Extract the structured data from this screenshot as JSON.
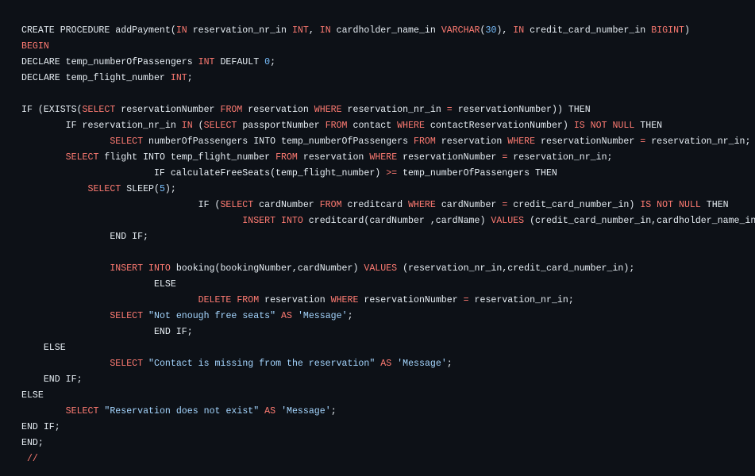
{
  "code_block": {
    "lines": [
      [
        [
          "CREATE PROCEDURE addPayment(",
          "plain"
        ],
        [
          "IN",
          "keyword"
        ],
        [
          " reservation_nr_in ",
          "plain"
        ],
        [
          "INT",
          "keyword"
        ],
        [
          ", ",
          "plain"
        ],
        [
          "IN",
          "keyword"
        ],
        [
          " cardholder_name_in ",
          "plain"
        ],
        [
          "VARCHAR",
          "keyword"
        ],
        [
          "(",
          "plain"
        ],
        [
          "30",
          "number"
        ],
        [
          "), ",
          "plain"
        ],
        [
          "IN",
          "keyword"
        ],
        [
          " credit_card_number_in ",
          "plain"
        ],
        [
          "BIGINT",
          "keyword"
        ],
        [
          ")",
          "plain"
        ]
      ],
      [
        [
          "BEGIN",
          "keyword"
        ]
      ],
      [
        [
          "DECLARE temp_numberOfPassengers ",
          "plain"
        ],
        [
          "INT",
          "keyword"
        ],
        [
          " DEFAULT ",
          "plain"
        ],
        [
          "0",
          "number"
        ],
        [
          ";",
          "plain"
        ]
      ],
      [
        [
          "DECLARE temp_flight_number ",
          "plain"
        ],
        [
          "INT",
          "keyword"
        ],
        [
          ";",
          "plain"
        ]
      ],
      [],
      [
        [
          "IF (EXISTS(",
          "plain"
        ],
        [
          "SELECT",
          "keyword"
        ],
        [
          " reservationNumber ",
          "plain"
        ],
        [
          "FROM",
          "keyword"
        ],
        [
          " reservation ",
          "plain"
        ],
        [
          "WHERE",
          "keyword"
        ],
        [
          " reservation_nr_in ",
          "plain"
        ],
        [
          "=",
          "op"
        ],
        [
          " reservationNumber)) THEN",
          "plain"
        ]
      ],
      [
        [
          "        IF reservation_nr_in ",
          "plain"
        ],
        [
          "IN",
          "keyword"
        ],
        [
          " (",
          "plain"
        ],
        [
          "SELECT",
          "keyword"
        ],
        [
          " passportNumber ",
          "plain"
        ],
        [
          "FROM",
          "keyword"
        ],
        [
          " contact ",
          "plain"
        ],
        [
          "WHERE",
          "keyword"
        ],
        [
          " contactReservationNumber) ",
          "plain"
        ],
        [
          "IS NOT NULL",
          "keyword"
        ],
        [
          " THEN",
          "plain"
        ]
      ],
      [
        [
          "                ",
          "plain"
        ],
        [
          "SELECT",
          "keyword"
        ],
        [
          " numberOfPassengers INTO temp_numberOfPassengers ",
          "plain"
        ],
        [
          "FROM",
          "keyword"
        ],
        [
          " reservation ",
          "plain"
        ],
        [
          "WHERE",
          "keyword"
        ],
        [
          " reservationNumber ",
          "plain"
        ],
        [
          "=",
          "op"
        ],
        [
          " reservation_nr_in;",
          "plain"
        ]
      ],
      [
        [
          "        ",
          "plain"
        ],
        [
          "SELECT",
          "keyword"
        ],
        [
          " flight INTO temp_flight_number ",
          "plain"
        ],
        [
          "FROM",
          "keyword"
        ],
        [
          " reservation ",
          "plain"
        ],
        [
          "WHERE",
          "keyword"
        ],
        [
          " reservationNumber ",
          "plain"
        ],
        [
          "=",
          "op"
        ],
        [
          " reservation_nr_in;",
          "plain"
        ]
      ],
      [
        [
          "                        IF calculateFreeSeats(temp_flight_number) ",
          "plain"
        ],
        [
          ">=",
          "op"
        ],
        [
          " temp_numberOfPassengers THEN",
          "plain"
        ]
      ],
      [
        [
          "            ",
          "plain"
        ],
        [
          "SELECT",
          "keyword"
        ],
        [
          " SLEEP(",
          "plain"
        ],
        [
          "5",
          "number"
        ],
        [
          ");",
          "plain"
        ]
      ],
      [
        [
          "                                IF (",
          "plain"
        ],
        [
          "SELECT",
          "keyword"
        ],
        [
          " cardNumber ",
          "plain"
        ],
        [
          "FROM",
          "keyword"
        ],
        [
          " creditcard ",
          "plain"
        ],
        [
          "WHERE",
          "keyword"
        ],
        [
          " cardNumber ",
          "plain"
        ],
        [
          "=",
          "op"
        ],
        [
          " credit_card_number_in) ",
          "plain"
        ],
        [
          "IS NOT NULL",
          "keyword"
        ],
        [
          " THEN",
          "plain"
        ]
      ],
      [
        [
          "                                        ",
          "plain"
        ],
        [
          "INSERT INTO",
          "keyword"
        ],
        [
          " creditcard(cardNumber ,cardName) ",
          "plain"
        ],
        [
          "VALUES",
          "keyword"
        ],
        [
          " (credit_card_number_in,cardholder_name_in);",
          "plain"
        ]
      ],
      [
        [
          "                END IF;",
          "plain"
        ]
      ],
      [],
      [
        [
          "                ",
          "plain"
        ],
        [
          "INSERT INTO",
          "keyword"
        ],
        [
          " booking(bookingNumber,cardNumber) ",
          "plain"
        ],
        [
          "VALUES",
          "keyword"
        ],
        [
          " (reservation_nr_in,credit_card_number_in);",
          "plain"
        ]
      ],
      [
        [
          "                        ELSE",
          "plain"
        ]
      ],
      [
        [
          "                                ",
          "plain"
        ],
        [
          "DELETE FROM",
          "keyword"
        ],
        [
          " reservation ",
          "plain"
        ],
        [
          "WHERE",
          "keyword"
        ],
        [
          " reservationNumber ",
          "plain"
        ],
        [
          "=",
          "op"
        ],
        [
          " reservation_nr_in;",
          "plain"
        ]
      ],
      [
        [
          "                ",
          "plain"
        ],
        [
          "SELECT",
          "keyword"
        ],
        [
          " ",
          "plain"
        ],
        [
          "\"Not enough free seats\"",
          "string"
        ],
        [
          " ",
          "plain"
        ],
        [
          "AS",
          "keyword"
        ],
        [
          " ",
          "plain"
        ],
        [
          "'Message'",
          "string"
        ],
        [
          ";",
          "plain"
        ]
      ],
      [
        [
          "                        END IF;",
          "plain"
        ]
      ],
      [
        [
          "    ELSE",
          "plain"
        ]
      ],
      [
        [
          "                ",
          "plain"
        ],
        [
          "SELECT",
          "keyword"
        ],
        [
          " ",
          "plain"
        ],
        [
          "\"Contact is missing from the reservation\"",
          "string"
        ],
        [
          " ",
          "plain"
        ],
        [
          "AS",
          "keyword"
        ],
        [
          " ",
          "plain"
        ],
        [
          "'Message'",
          "string"
        ],
        [
          ";",
          "plain"
        ]
      ],
      [
        [
          "    END IF;",
          "plain"
        ]
      ],
      [
        [
          "ELSE",
          "plain"
        ]
      ],
      [
        [
          "        ",
          "plain"
        ],
        [
          "SELECT",
          "keyword"
        ],
        [
          " ",
          "plain"
        ],
        [
          "\"Reservation does not exist\"",
          "string"
        ],
        [
          " ",
          "plain"
        ],
        [
          "AS",
          "keyword"
        ],
        [
          " ",
          "plain"
        ],
        [
          "'Message'",
          "string"
        ],
        [
          ";",
          "plain"
        ]
      ],
      [
        [
          "END IF;",
          "plain"
        ]
      ],
      [
        [
          "END;",
          "plain"
        ]
      ],
      [
        [
          " //",
          "comment"
        ]
      ]
    ]
  },
  "colors": {
    "background": "#0d1117",
    "plain": "#e6edf3",
    "keyword": "#ff7b72",
    "number": "#79c0ff",
    "string": "#a5d6ff"
  }
}
